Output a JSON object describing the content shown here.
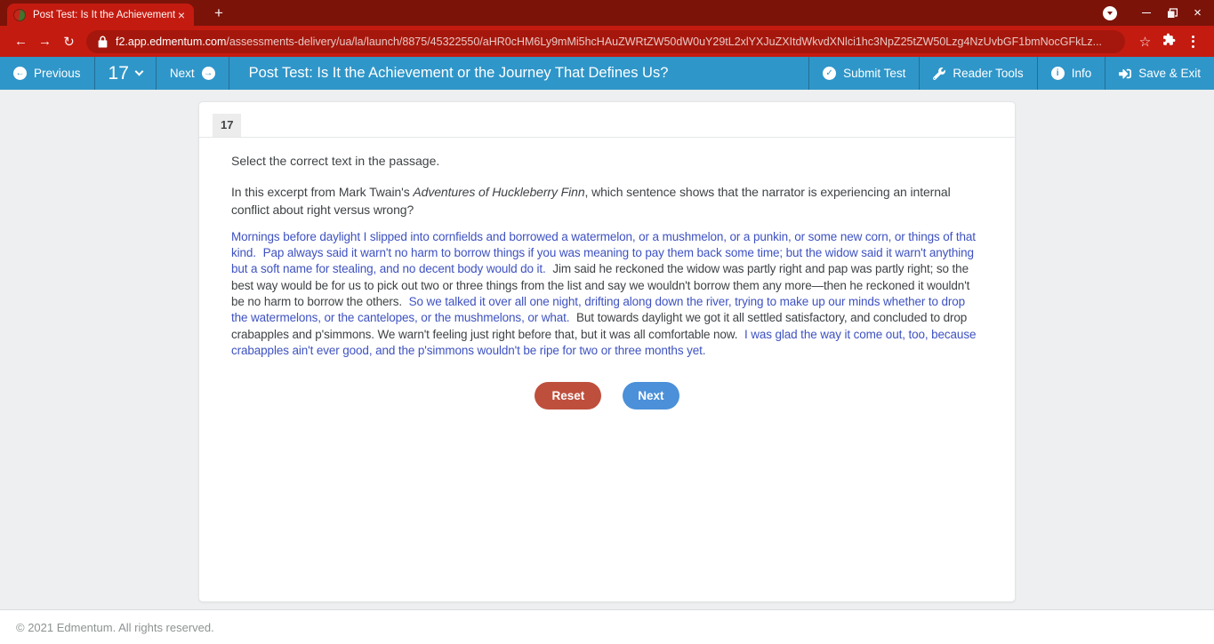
{
  "browser": {
    "tab_title": "Post Test: Is It the Achievement",
    "url_domain": "f2.app.edmentum.com",
    "url_path": "/assessments-delivery/ua/la/launch/8875/45322550/aHR0cHM6Ly9mMi5hcHAuZWRtZW50dW0uY29tL2xlYXJuZXItdWkvdXNlci1hc3NpZ25tZW50Lzg4NzUvbGF1bmNocGFkLz..."
  },
  "icons": {
    "back": "←",
    "forward": "→",
    "reload": "↻",
    "star": "☆",
    "new_tab": "+",
    "close_tab": "×",
    "close_window": "×",
    "prev_arrow": "←",
    "next_arrow": "→",
    "check": "✓",
    "info": "i"
  },
  "toolbar": {
    "previous_label": "Previous",
    "question_number": "17",
    "next_label": "Next",
    "title": "Post Test: Is It the Achievement or the Journey That Defines Us?",
    "submit_label": "Submit Test",
    "reader_tools_label": "Reader Tools",
    "info_label": "Info",
    "save_exit_label": "Save & Exit"
  },
  "question": {
    "number": "17",
    "instruction": "Select the correct text in the passage.",
    "prompt_before": "In this excerpt from Mark Twain's ",
    "prompt_italic": "Adventures of Huckleberry Finn",
    "prompt_after": ", which sentence shows that the narrator is experiencing an internal conflict about right versus wrong?"
  },
  "passage": {
    "segments": [
      {
        "kind": "selectable",
        "text": "Mornings before daylight I slipped into cornfields and borrowed a watermelon, or a mushmelon, or a punkin, or some new corn, or things of that kind."
      },
      {
        "kind": "selectable",
        "text": "Pap always said it warn't no harm to borrow things if you was meaning to pay them back some time; but the widow said it warn't anything but a soft name for stealing, and no decent body would do it."
      },
      {
        "kind": "plain",
        "text": "Jim said he reckoned the widow was partly right and pap was partly right; so the best way would be for us to pick out two or three things from the list and say we wouldn't borrow them any more—then he reckoned it wouldn't be no harm to borrow the others."
      },
      {
        "kind": "selectable",
        "text": "So we talked it over all one night, drifting along down the river, trying to make up our minds whether to drop the watermelons, or the cantelopes, or the mushmelons, or what."
      },
      {
        "kind": "plain",
        "text": "But towards daylight we got it all settled satisfactory, and concluded to drop crabapples and p'simmons. We warn't feeling just right before that, but it was all comfortable now."
      },
      {
        "kind": "selectable",
        "text": "I was glad the way it come out, too, because crabapples ain't ever good, and the p'simmons wouldn't be ripe for two or three months yet."
      }
    ]
  },
  "actions": {
    "reset_label": "Reset",
    "next_label": "Next"
  },
  "footer": {
    "copyright": "© 2021 Edmentum. All rights reserved."
  },
  "colors": {
    "chrome_red": "#c41b10",
    "chrome_dark_red": "#7b1309",
    "url_field_red": "#a5170c",
    "app_toolbar_blue": "#2f96c9",
    "selectable_text_blue": "#3e52c1",
    "body_text": "#3f4346",
    "reset_button_red": "#bf4f3d",
    "next_button_blue": "#4b90d9",
    "page_background": "#edeff0"
  }
}
